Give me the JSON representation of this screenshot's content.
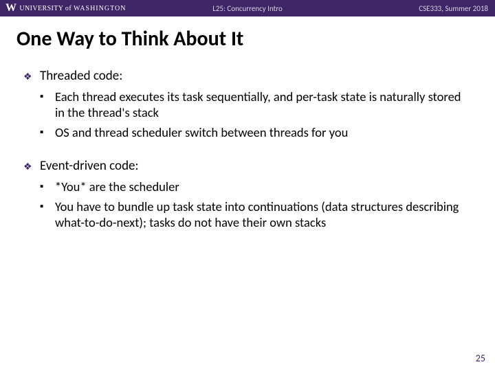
{
  "header": {
    "logo_w": "W",
    "logo_uni": "UNIVERSITY of",
    "logo_wash": "WASHINGTON",
    "center": "L25:  Concurrency Intro",
    "right": "CSE333, Summer 2018"
  },
  "title": "One Way to Think About It",
  "sections": [
    {
      "heading": "Threaded code:",
      "items": [
        "Each thread executes its task sequentially, and per-task state is naturally stored in the thread's stack",
        "OS and thread scheduler switch between threads for you"
      ]
    },
    {
      "heading": "Event-driven code:",
      "items": [
        "*You* are the scheduler",
        "You have to bundle up task state into continuations (data structures describing what-to-do-next); tasks do not have their own stacks"
      ]
    }
  ],
  "page_number": "25"
}
